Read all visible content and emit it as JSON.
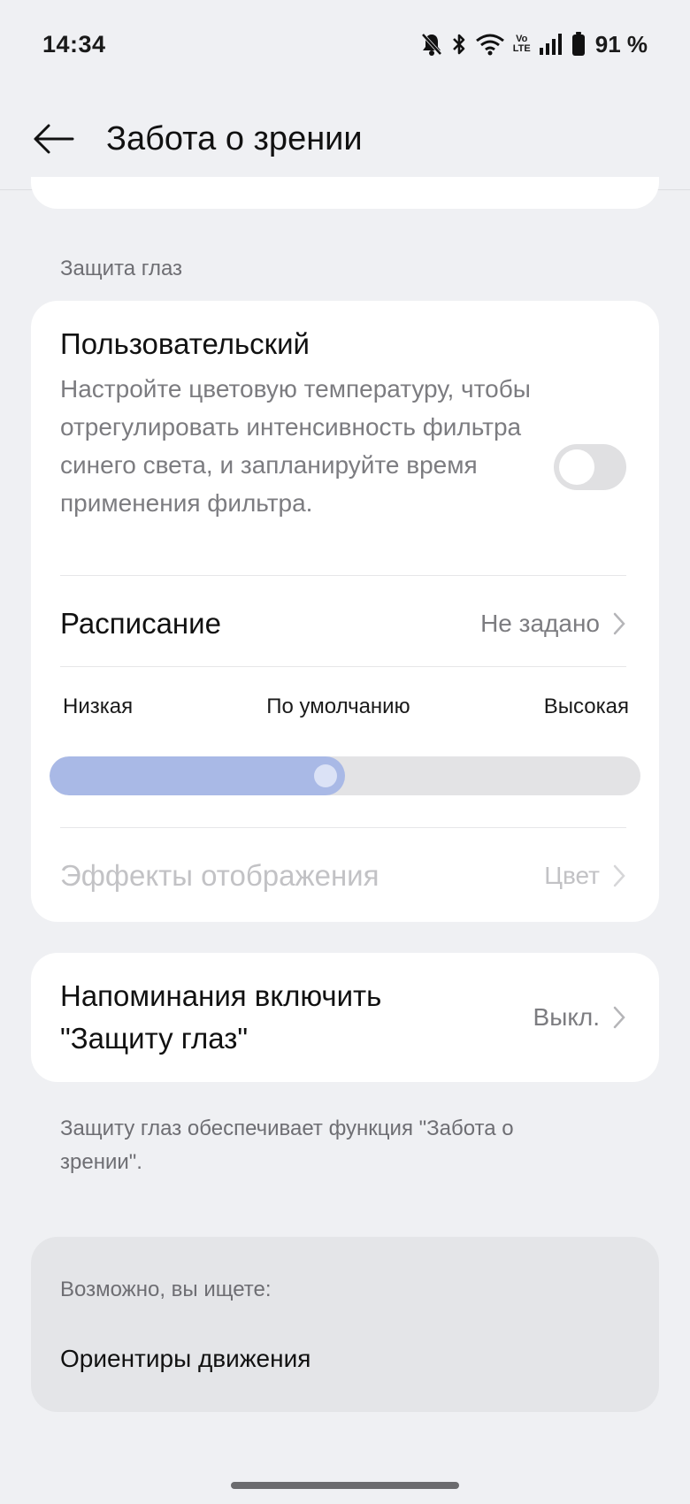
{
  "status_bar": {
    "time": "14:34",
    "volte_top": "Vo",
    "volte_bottom": "LTE",
    "battery": "91 %",
    "icons": [
      "mute-icon",
      "bluetooth-icon",
      "wifi-icon",
      "volte-icon",
      "signal-icon",
      "battery-icon"
    ]
  },
  "header": {
    "title": "Забота о зрении",
    "back_icon": "back-arrow-icon"
  },
  "eye_protection": {
    "section_label": "Защита глаз",
    "custom": {
      "title": "Пользовательский",
      "description": "Настройте цветовую температуру, чтобы отрегулировать интенсивность фильтра синего света, и запланируйте время применения фильтра.",
      "enabled": false
    },
    "schedule": {
      "label": "Расписание",
      "value": "Не задано"
    },
    "intensity": {
      "low_label": "Низкая",
      "default_label": "По умолчанию",
      "high_label": "Высокая",
      "level": 0.5
    },
    "display_effects": {
      "label": "Эффекты отображения",
      "value": "Цвет"
    }
  },
  "reminder": {
    "label": "Напоминания включить \"Защиту глаз\"",
    "value": "Выкл."
  },
  "footnote": "Защиту глаз обеспечивает функция \"Забота о зрении\".",
  "suggestions": {
    "label": "Возможно, вы ищете:",
    "item": "Ориентиры движения"
  },
  "colors": {
    "background": "#eff0f3",
    "card": "#ffffff",
    "slider_fill": "#a9b9e6",
    "slider_track": "#e3e3e5",
    "secondary_text": "#7c7c80"
  }
}
